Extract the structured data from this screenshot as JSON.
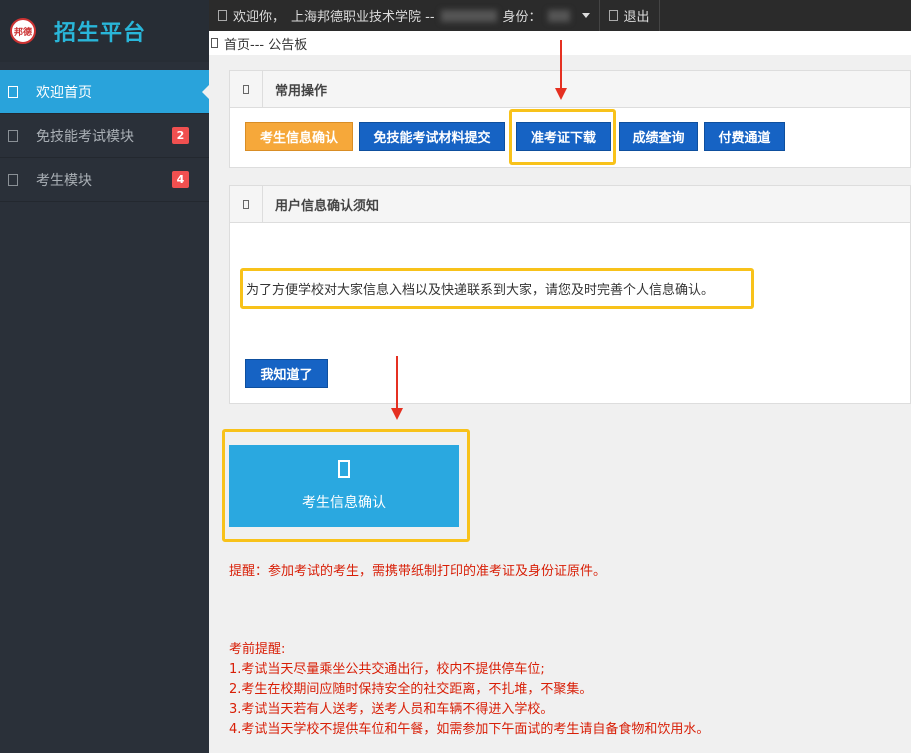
{
  "brand": {
    "title": "招生平台",
    "logo_text": "邦德"
  },
  "sidebar": {
    "items": [
      {
        "label": "欢迎首页",
        "badge": null,
        "active": true
      },
      {
        "label": "免技能考试模块",
        "badge": "2"
      },
      {
        "label": "考生模块",
        "badge": "4"
      }
    ]
  },
  "topbar": {
    "welcome": "欢迎你，",
    "school": "上海邦德职业技术学院 --",
    "identity_label": "身份：",
    "logout": "退出"
  },
  "breadcrumb": {
    "text": "首页--- 公告板"
  },
  "ops_panel": {
    "title": "常用操作",
    "buttons": [
      "考生信息确认",
      "免技能考试材料提交",
      "准考证下载",
      "成绩查询",
      "付费通道"
    ]
  },
  "notice_panel": {
    "title": "用户信息确认须知",
    "text": "为了方便学校对大家信息入档以及快递联系到大家，请您及时完善个人信息确认。",
    "button": "我知道了"
  },
  "tile": {
    "label": "考生信息确认"
  },
  "reminder": "提醒：参加考试的考生，需携带纸制打印的准考证及身份证原件。",
  "pre_exam": {
    "title": "考前提醒:",
    "items": [
      "1.考试当天尽量乘坐公共交通出行，校内不提供停车位;",
      "2.考生在校期间应随时保持安全的社交距离，不扎堆，不聚集。",
      "3.考试当天若有人送考，送考人员和车辆不得进入学校。",
      "4.考试当天学校不提供车位和午餐，如需参加下午面试的考生请自备食物和饮用水。"
    ]
  },
  "colors": {
    "sidebar": "#2a3039",
    "accent": "#29a3db",
    "button": "#1663c4",
    "orange": "#f6a83a",
    "highlight": "#f8c21a",
    "arrow": "#e53021",
    "warning": "#d81e06"
  }
}
